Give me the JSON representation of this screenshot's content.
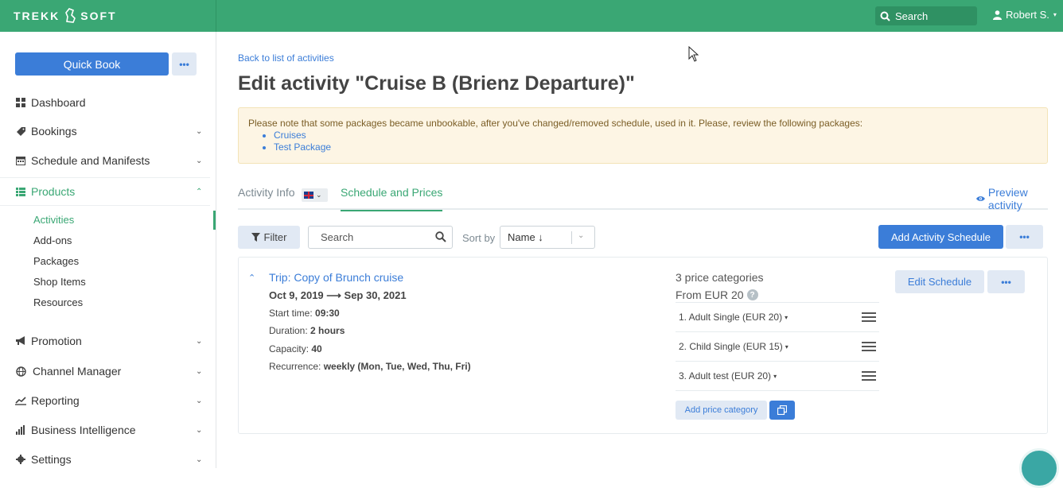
{
  "topbar": {
    "logo_left": "TREKK",
    "logo_right": "SOFT",
    "search_label": "Search",
    "user_name": "Robert S."
  },
  "sidebar": {
    "quick_book": "Quick Book",
    "nav": [
      {
        "label": "Dashboard",
        "icon": "dashboard-icon"
      },
      {
        "label": "Bookings",
        "icon": "ticket-icon"
      },
      {
        "label": "Schedule and Manifests",
        "icon": "calendar-icon"
      },
      {
        "label": "Products",
        "icon": "list-icon"
      },
      {
        "label": "Promotion",
        "icon": "megaphone-icon"
      },
      {
        "label": "Channel Manager",
        "icon": "globe-icon"
      },
      {
        "label": "Reporting",
        "icon": "line-chart-icon"
      },
      {
        "label": "Business Intelligence",
        "icon": "bar-chart-icon"
      },
      {
        "label": "Settings",
        "icon": "gear-icon"
      }
    ],
    "products_sub": [
      "Activities",
      "Add-ons",
      "Packages",
      "Shop Items",
      "Resources"
    ]
  },
  "main": {
    "back_link": "Back to list of activities",
    "title": "Edit activity \"Cruise B (Brienz Departure)\"",
    "alert": {
      "text": "Please note that some packages became unbookable, after you've changed/removed schedule, used in it. Please, review the following packages:",
      "packages": [
        "Cruises",
        "Test Package"
      ]
    },
    "tabs": {
      "activity_info": "Activity Info",
      "schedule_prices": "Schedule and Prices",
      "preview": "Preview activity"
    },
    "toolbar": {
      "filter": "Filter",
      "search_placeholder": "Search",
      "sort_by": "Sort by",
      "sort_value": "Name ↓",
      "add_schedule": "Add Activity Schedule"
    },
    "schedule": {
      "trip_title": "Trip: Copy of Brunch cruise",
      "dates": "Oct 9, 2019 ⟶ Sep 30, 2021",
      "start_label": "Start time:",
      "start_value": "09:30",
      "duration_label": "Duration:",
      "duration_value": "2 hours",
      "capacity_label": "Capacity:",
      "capacity_value": "40",
      "recurrence_label": "Recurrence:",
      "recurrence_value": "weekly (Mon, Tue, Wed, Thu, Fri)",
      "price_count": "3 price categories",
      "price_from": "From EUR 20",
      "price_categories": [
        "1. Adult Single (EUR 20)",
        "2. Child Single (EUR 15)",
        "3. Adult test (EUR 20)"
      ],
      "add_price_category": "Add price category",
      "edit_schedule": "Edit Schedule"
    }
  },
  "colors": {
    "brand_green": "#3aa774",
    "primary_blue": "#3b7dd8",
    "alert_bg": "#fdf5e4"
  }
}
